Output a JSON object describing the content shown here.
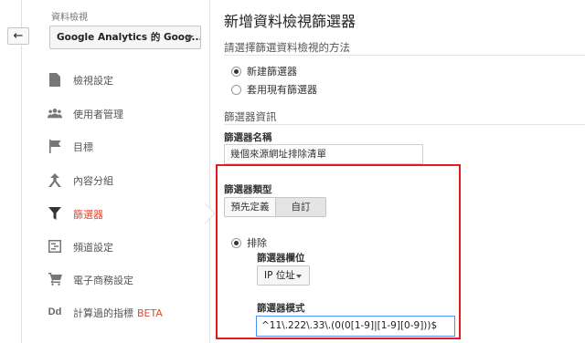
{
  "nav_back": {
    "icon": "back-arrow-icon",
    "glyph": "←"
  },
  "sidebar": {
    "view_label": "資料檢視",
    "view_select": "Google Analytics 的 Goog...",
    "items": [
      {
        "label": "檢視設定",
        "icon": "document-icon"
      },
      {
        "label": "使用者管理",
        "icon": "users-icon"
      },
      {
        "label": "目標",
        "icon": "flag-icon"
      },
      {
        "label": "內容分組",
        "icon": "content-grouping-icon"
      },
      {
        "label": "篩選器",
        "icon": "filter-icon",
        "active": true
      },
      {
        "label": "頻道設定",
        "icon": "channel-settings-icon"
      },
      {
        "label": "電子商務設定",
        "icon": "cart-icon"
      },
      {
        "label": "計算過的指標",
        "badge": "BETA",
        "icon": "dd-icon"
      }
    ]
  },
  "main": {
    "title": "新增資料檢視篩選器",
    "method_title": "請選擇篩選資料檢視的方法",
    "method_options": [
      {
        "label": "新建篩選器",
        "selected": true
      },
      {
        "label": "套用現有篩選器",
        "selected": false
      }
    ],
    "info_title": "篩選器資訊",
    "name_label": "篩選器名稱",
    "name_value": "幾個來源網址排除清單",
    "type_label": "篩選器類型",
    "type_buttons": {
      "predefined": "預先定義",
      "custom": "自訂"
    },
    "exclude_label": "排除",
    "field_label": "篩選器欄位",
    "field_value": "IP 位址",
    "pattern_label": "篩選器模式",
    "pattern_value": "^11\\.222\\.33\\.(0(0[1-9]|[1-9][0-9]))$"
  },
  "colors": {
    "accent": "#e04a2f",
    "highlight_box": "#e01e1e",
    "focus": "#4d90fe"
  }
}
